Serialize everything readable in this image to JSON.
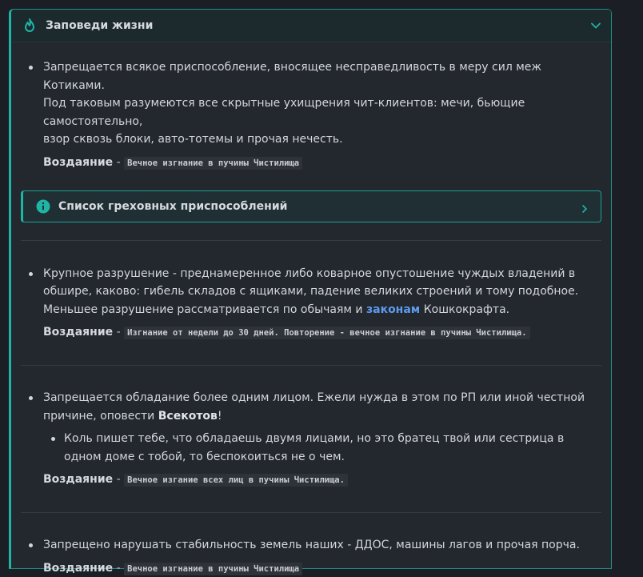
{
  "panel": {
    "title": "Заповеди жизни",
    "accent_color": "#1fb5a6",
    "icon": "fire-icon",
    "toggle_icon": "chevron-down-icon"
  },
  "rules": [
    {
      "line1": "Запрещается всякое приспособление, вносящее несправедливость в меру сил меж Котиками.",
      "line2": "Под таковым разумеются все скрытные ухищрения чит-клиентов: мечи, бьющие самостоятельно,",
      "line3": "взор сквозь блоки, авто-тотемы и прочая нечесть.",
      "penalty_label": "Воздаяние",
      "penalty_sep": "-",
      "penalty_text": "Вечное изгнание в пучины Чистилища"
    },
    {
      "text_before": "Крупное разрушение - преднамеренное либо коварное опустошение чуждых владений в обшире, каково: гибель складов с ящиками, падение великих строений и тому подобное. Меньшее разрушение рассматривается по обычаям и ",
      "link": "законам",
      "text_after": " Кошкокрафта.",
      "penalty_label": "Воздаяние",
      "penalty_sep": "-",
      "penalty_text": "Изгнание от недели до 30 дней. Повторение - вечное изгнание в пучины Чистилища."
    },
    {
      "text_before": "Запрещается обладание более одним лицом. Ежели нужда в этом по РП или иной честной причине, оповести ",
      "bold": "Всекотов",
      "text_after": "!",
      "sub_item": "Коль пишет тебе, что обладаешь двумя лицами, но это братец твой или сестрица в одном доме с тобой, то беспокоиться не о чем.",
      "penalty_label": "Воздаяние",
      "penalty_sep": "-",
      "penalty_text": "Вечное изгание всех лиц в пучины Чистилища."
    },
    {
      "text": "Запрещено нарушать стабильность земель наших - ДДОС, машины лагов и прочая порча.",
      "penalty_label": "Воздаяние",
      "penalty_sep": "-",
      "penalty_text": "Вечное изгнание в пучины Чистилища"
    }
  ],
  "callout": {
    "title": "Список греховных приспособлений",
    "icon": "info-icon",
    "arrow_icon": "chevron-right-icon"
  }
}
